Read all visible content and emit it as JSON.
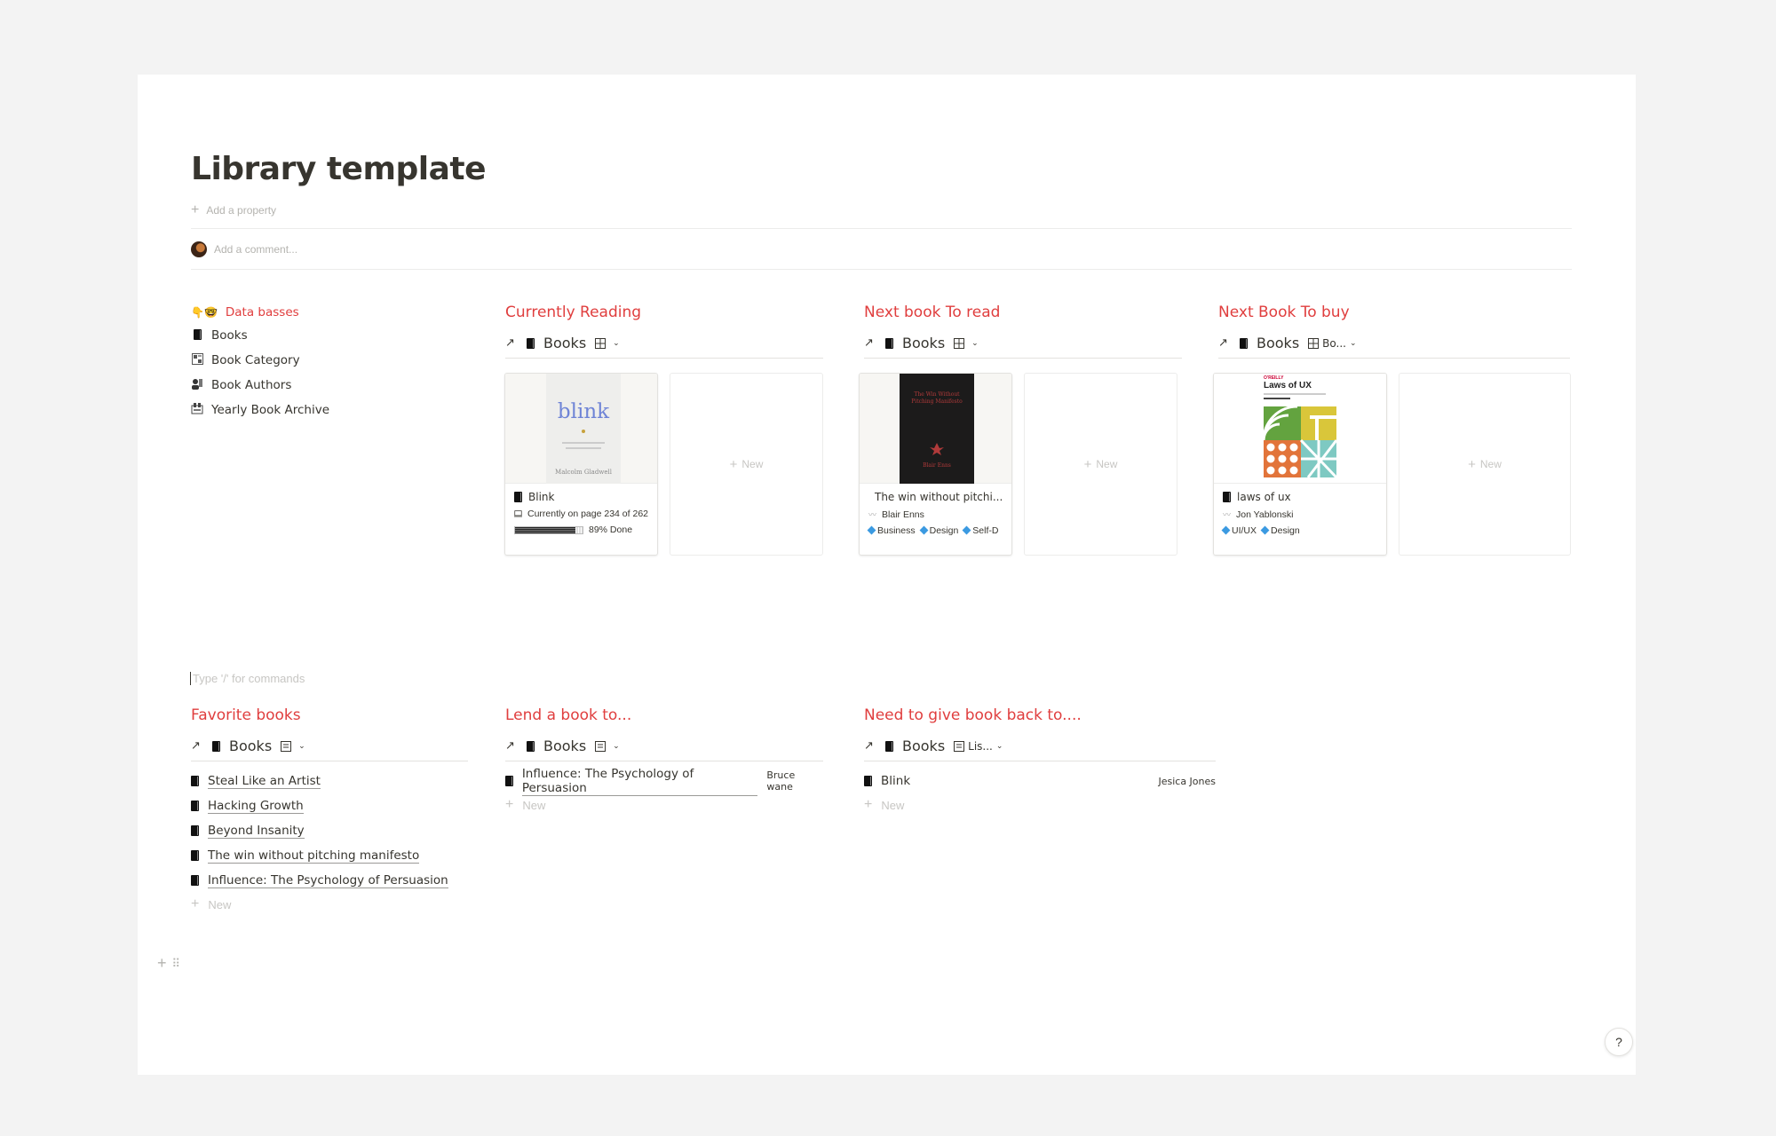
{
  "page": {
    "title": "Library template",
    "add_property": "Add a property",
    "add_comment": "Add a comment...",
    "command_placeholder": "Type '/' for commands",
    "help": "?"
  },
  "sidebar": {
    "heading": "Data basses",
    "heading_emoji": "👇🤓",
    "items": [
      {
        "label": "Books",
        "icon": "book-icon"
      },
      {
        "label": "Book Category",
        "icon": "category-icon"
      },
      {
        "label": "Book Authors",
        "icon": "authors-icon"
      },
      {
        "label": "Yearly Book Archive",
        "icon": "archive-icon"
      }
    ]
  },
  "galleries": [
    {
      "heading": "Currently Reading",
      "db": "Books",
      "view": "",
      "card": {
        "name": "Blink",
        "cover_title": "blink",
        "cover_author": "Malcolm Gladwell",
        "progress_text": "Currently on page 234 of 262",
        "progress_bar": "▓▓▓▓▓▓▓▓▓▓░░░",
        "progress_done": "89% Done",
        "progress": 0.89
      },
      "new": "New"
    },
    {
      "heading": "Next book To read",
      "db": "Books",
      "view": "",
      "card": {
        "name": "The win without pitchi...",
        "cover_title": "The Win Without Pitching Manifesto",
        "cover_author": "Blair Enns",
        "author": "Blair Enns",
        "tags": [
          "Business",
          "Design",
          "Self-D"
        ]
      },
      "new": "New"
    },
    {
      "heading": "Next Book To buy",
      "db": "Books",
      "view": "Bo...",
      "card": {
        "name": "laws of ux",
        "cover_publisher": "O'REILLY",
        "cover_title": "Laws of UX",
        "author": "Jon Yablonski",
        "tags": [
          "UI/UX",
          "Design"
        ]
      },
      "new": "New"
    }
  ],
  "lists": [
    {
      "heading": "Favorite books",
      "db": "Books",
      "view": "",
      "items": [
        "Steal Like an Artist",
        "Hacking Growth",
        "Beyond Insanity",
        "The win without pitching manifesto",
        "Influence: The Psychology of Persuasion"
      ],
      "new": "New"
    },
    {
      "heading": "Lend a book to...",
      "db": "Books",
      "view": "",
      "items": [
        {
          "title": "Influence: The Psychology of Persuasion",
          "person": "Bruce wane"
        }
      ],
      "new": "New"
    },
    {
      "heading": "Need to give book back to....",
      "db": "Books",
      "view": "Lis...",
      "items": [
        {
          "title": "Blink",
          "person": "Jesica Jones"
        }
      ],
      "new": "New"
    }
  ],
  "colors": {
    "accent_red": "#e03e3e",
    "tag_blue": "#3b9ae1",
    "text": "#37352f",
    "muted": "#b4b3af"
  }
}
